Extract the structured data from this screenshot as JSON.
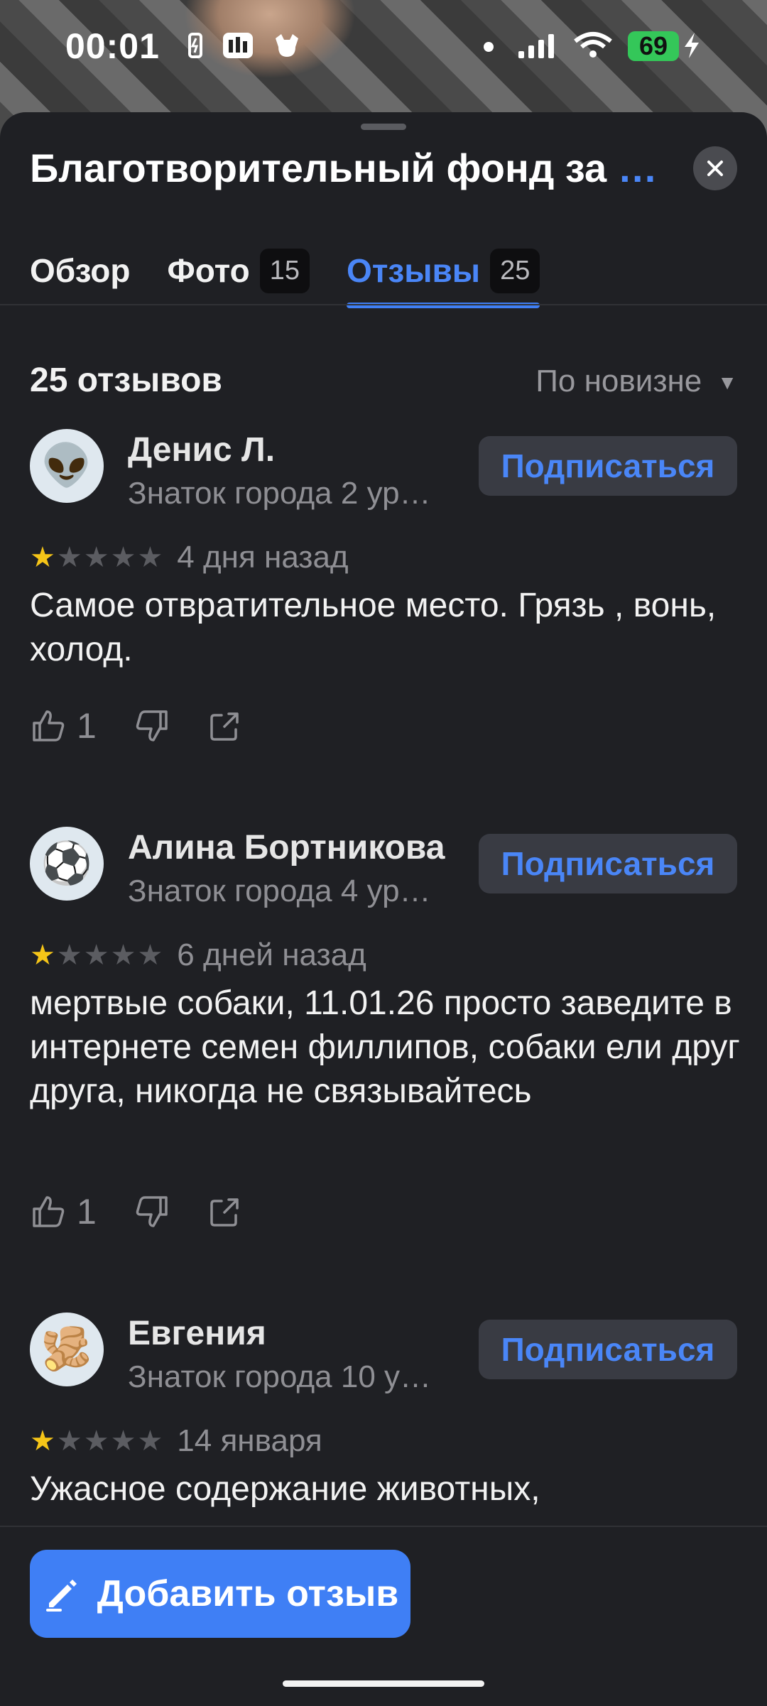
{
  "status_bar": {
    "time": "00:01",
    "battery": "69"
  },
  "sheet": {
    "title": "Благотворительный фонд за",
    "title_more": "…",
    "tabs": [
      {
        "label": "Обзор",
        "badge": ""
      },
      {
        "label": "Фото",
        "badge": "15"
      },
      {
        "label": "Отзывы",
        "badge": "25"
      }
    ],
    "active_tab": "Отзывы",
    "reviews_count": "25 отзывов",
    "sort_label": "По новизне"
  },
  "reviews": [
    {
      "name": "Денис Л.",
      "level": "Знаток города 2 ур…",
      "subscribe": "Подписаться",
      "rating": 1,
      "date": "4 дня назад",
      "text": "Самое отвратительное место. Грязь , вонь, холод.",
      "likes": "1",
      "avatar_emoji": "👽"
    },
    {
      "name": "Алина Бортникова",
      "level": "Знаток города 4 ур…",
      "subscribe": "Подписаться",
      "rating": 1,
      "date": "6 дней назад",
      "text": "мертвые собаки, 11.01.26 просто заведите в интернете семен филлипов, собаки ели друг друга, никогда не связывайтесь",
      "likes": "1",
      "avatar_emoji": "⚽"
    },
    {
      "name": "Евгения",
      "level": "Знаток города 10 у…",
      "subscribe": "Подписаться",
      "rating": 1,
      "date": "14 января",
      "text": "Ужасное содержание животных,",
      "likes": "",
      "avatar_emoji": "🫚"
    }
  ],
  "bottom": {
    "add_review": "Добавить отзыв"
  },
  "colors": {
    "accent": "#3f7ff5",
    "star": "#f5c518",
    "background": "#1f2024"
  }
}
